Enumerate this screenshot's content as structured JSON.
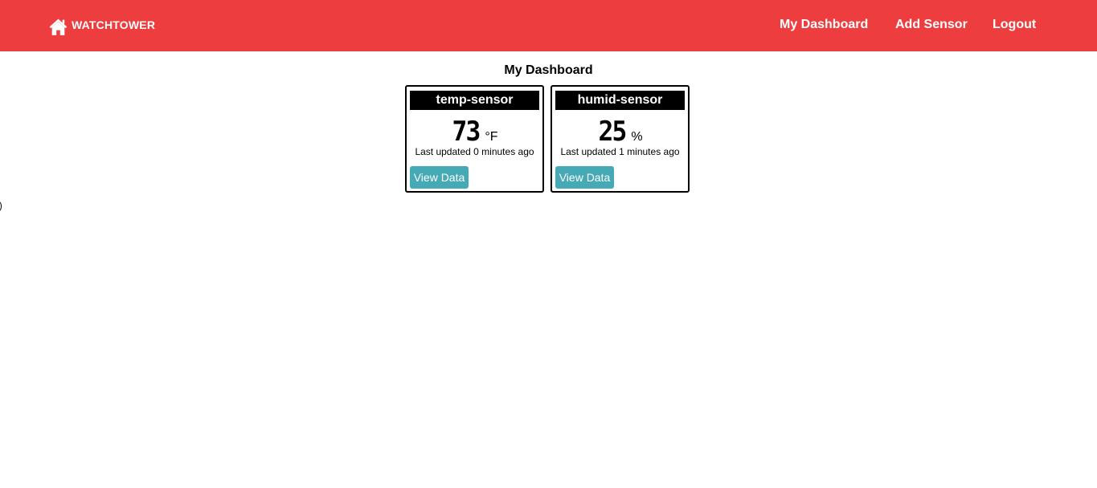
{
  "navbar": {
    "brand": "WATCHTOWER",
    "brand_icon": "home-icon",
    "background": "#ee3d3f",
    "links": [
      "My Dashboard",
      "Add Sensor",
      "Logout"
    ]
  },
  "page": {
    "title": "My Dashboard"
  },
  "sensors": [
    {
      "name": "temp-sensor",
      "value": "73",
      "unit": "°F",
      "updated": "Last updated 0 minutes ago",
      "button": "View Data"
    },
    {
      "name": "humid-sensor",
      "value": "25",
      "unit": "%",
      "updated": "Last updated 1 minutes ago",
      "button": "View Data"
    }
  ],
  "colors": {
    "button": "#45a9b6",
    "card_header": "#000000"
  }
}
